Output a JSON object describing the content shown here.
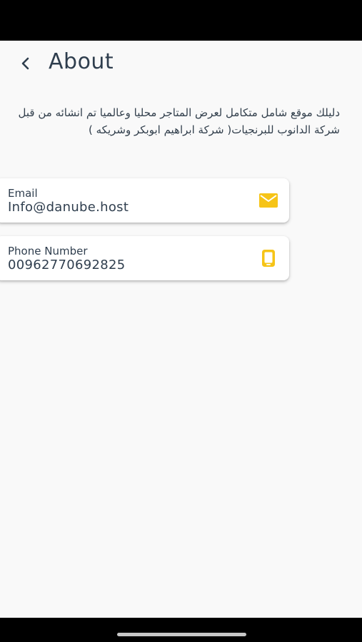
{
  "header": {
    "title": "About",
    "back_icon": "chevron-left-icon"
  },
  "about": {
    "description": "دليلك موقع شامل متكامل لعرض المتاجر محليا وعالميا تم انشائه من قبل شركة الدانوب للبرنجيات( شركة ابراهيم ابوبكر وشريكه )"
  },
  "contacts": [
    {
      "label": "Email",
      "value": "Info@danube.host",
      "icon": "mail-icon"
    },
    {
      "label": "Phone Number",
      "value": "00962770692825",
      "icon": "smartphone-icon"
    }
  ],
  "colors": {
    "accent": "#f6c417",
    "text": "#2f3e4e",
    "background": "#f9f9f9",
    "card": "#ffffff"
  }
}
